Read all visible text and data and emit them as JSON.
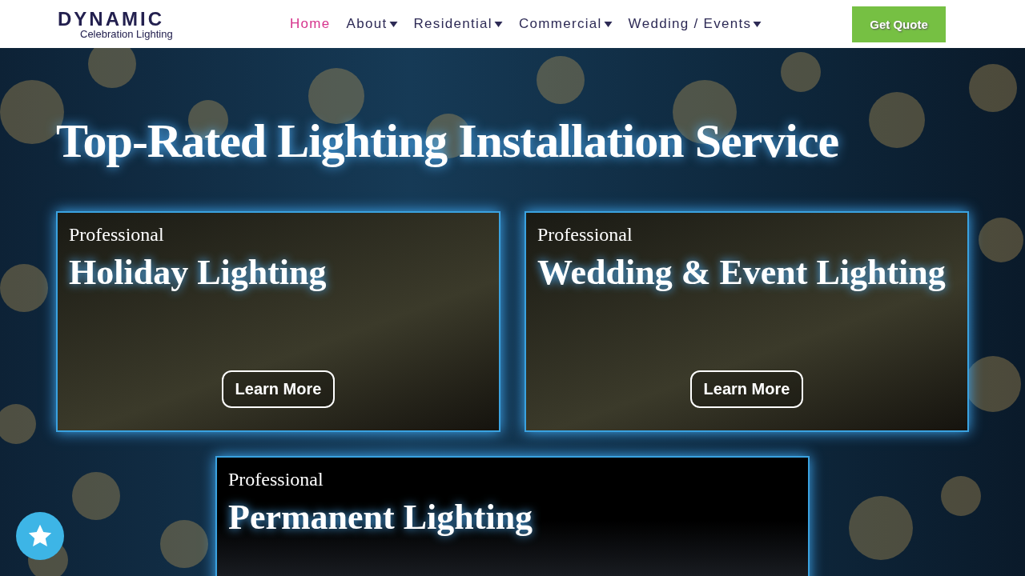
{
  "logo": {
    "title": "DYNAMIC",
    "subtitle": "Celebration Lighting"
  },
  "nav": [
    {
      "label": "Home",
      "selected": true,
      "dropdown": false
    },
    {
      "label": "About",
      "selected": false,
      "dropdown": true
    },
    {
      "label": "Residential",
      "selected": false,
      "dropdown": true
    },
    {
      "label": "Commercial",
      "selected": false,
      "dropdown": true
    },
    {
      "label": "Wedding / Events",
      "selected": false,
      "dropdown": true
    }
  ],
  "cta": "Get Quote",
  "hero": {
    "title": "Top-Rated Lighting Installation Service"
  },
  "cards": [
    {
      "eyebrow": "Professional",
      "title": "Holiday Lighting",
      "button": "Learn More"
    },
    {
      "eyebrow": "Professional",
      "title": "Wedding & Event Lighting",
      "button": "Learn More"
    },
    {
      "eyebrow": "Professional",
      "title": "Permanent Lighting"
    }
  ]
}
